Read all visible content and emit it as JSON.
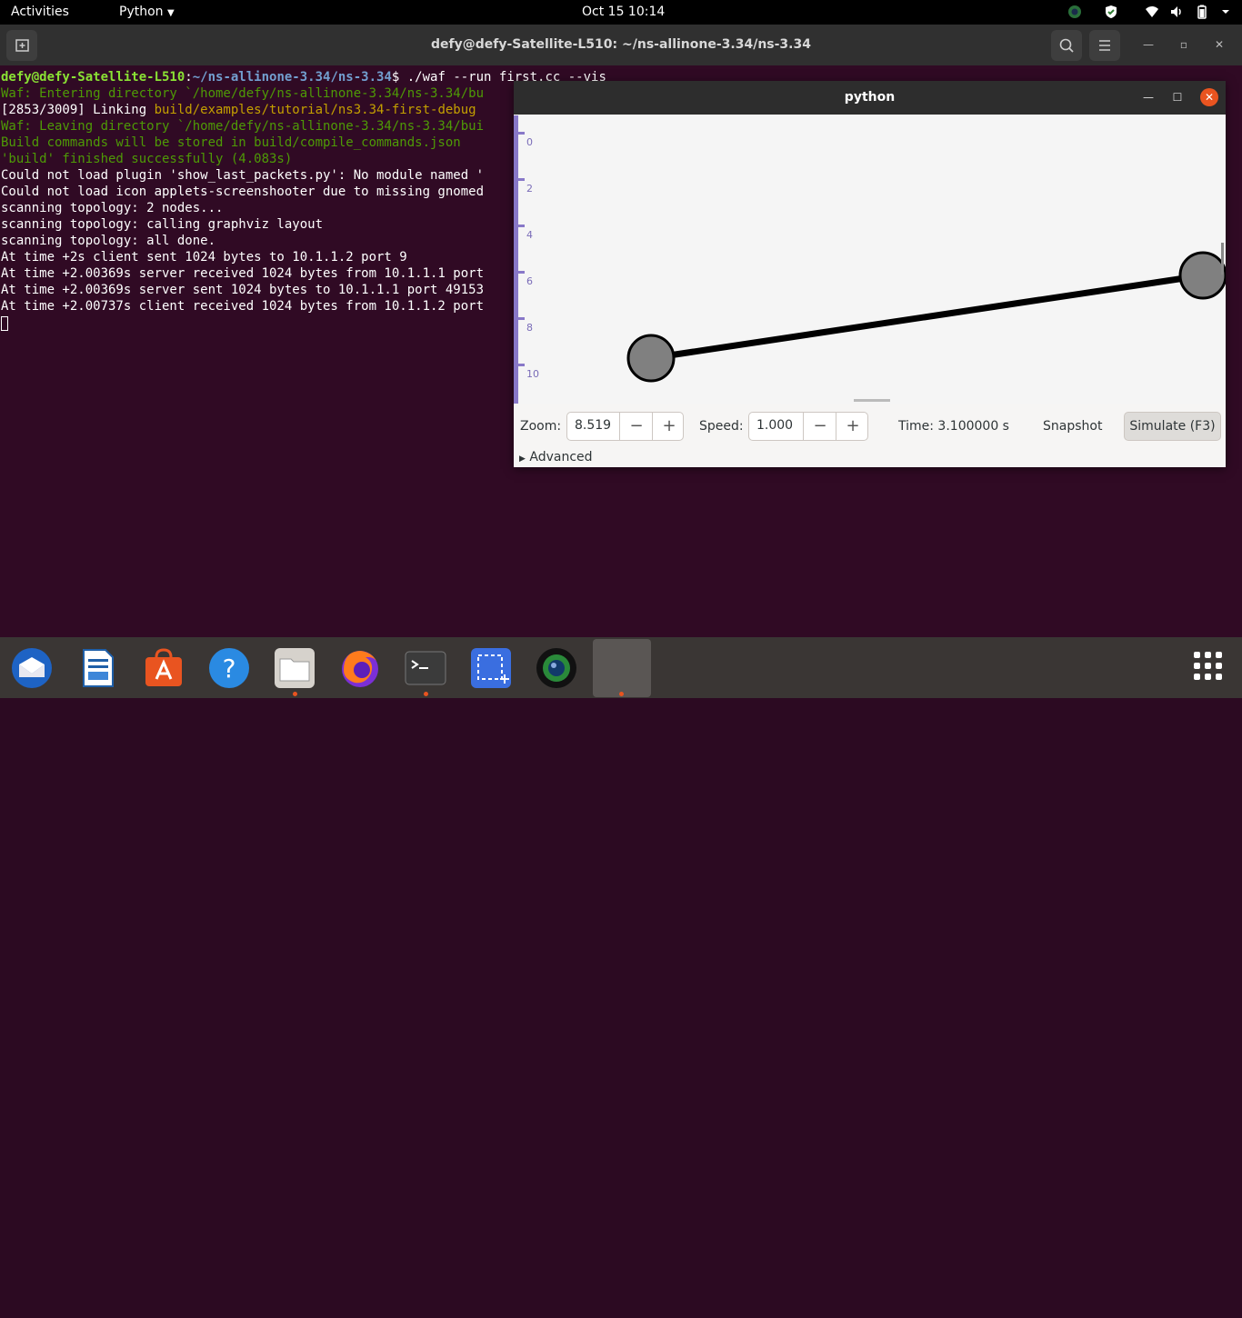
{
  "topbar": {
    "activities": "Activities",
    "app_menu": "Python",
    "clock": "Oct 15  10:14"
  },
  "terminal": {
    "title": "defy@defy-Satellite-L510: ~/ns-allinone-3.34/ns-3.34",
    "prompt_user": "defy@defy-Satellite-L510",
    "prompt_path": "~/ns-allinone-3.34/ns-3.34",
    "command": "$ ./waf --run first.cc --vis",
    "lines": {
      "l2": "Waf: Entering directory `/home/defy/ns-allinone-3.34/ns-3.34/bu",
      "l3_prefix": "[2853/3009] Linking ",
      "l3_path": "build/examples/tutorial/ns3.34-first-debug",
      "l4": "Waf: Leaving directory `/home/defy/ns-allinone-3.34/ns-3.34/bui",
      "l5": "Build commands will be stored in build/compile_commands.json",
      "l6": "'build' finished successfully (4.083s)",
      "l7": "Could not load plugin 'show_last_packets.py': No module named '",
      "l8": "Could not load icon applets-screenshooter due to missing gnomed",
      "l9": "scanning topology: 2 nodes...",
      "l10": "scanning topology: calling graphviz layout",
      "l11": "scanning topology: all done.",
      "l12": "At time +2s client sent 1024 bytes to 10.1.1.2 port 9",
      "l13": "At time +2.00369s server received 1024 bytes from 10.1.1.1 port",
      "l14": "At time +2.00369s server sent 1024 bytes to 10.1.1.1 port 49153",
      "l15": "At time +2.00737s client received 1024 bytes from 10.1.1.2 port"
    }
  },
  "pyvis": {
    "title": "python",
    "ruler_ticks": [
      "0",
      "2",
      "4",
      "6",
      "8",
      "10"
    ],
    "controls": {
      "zoom_label": "Zoom:",
      "zoom_value": "8.519",
      "speed_label": "Speed:",
      "speed_value": "1.000",
      "minus": "−",
      "plus": "+",
      "time": "Time: 3.100000 s",
      "snapshot": "Snapshot",
      "simulate": "Simulate (F3)",
      "advanced": "Advanced"
    },
    "colors": {
      "node_fill": "#808080",
      "link": "#000000"
    }
  },
  "dock": {
    "items": [
      "thunderbird-icon",
      "libreoffice-writer-icon",
      "software-center-icon",
      "help-icon",
      "files-icon",
      "firefox-icon",
      "terminal-icon",
      "screenshot-icon",
      "webcam-icon",
      "python-app-icon"
    ]
  },
  "colors": {
    "terminal_bg": "#300a24",
    "accent": "#e95420"
  }
}
